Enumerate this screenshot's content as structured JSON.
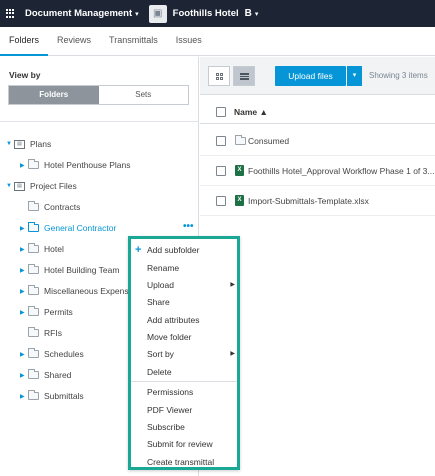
{
  "topbar": {
    "app_title": "Document Management",
    "project_name": "Foothills Hotel",
    "project_badge": "B",
    "caret": "▾"
  },
  "tabs": [
    {
      "label": "Folders",
      "active": true
    },
    {
      "label": "Reviews"
    },
    {
      "label": "Transmittals"
    },
    {
      "label": "Issues"
    }
  ],
  "viewby": {
    "label": "View by",
    "options": [
      "Folders",
      "Sets"
    ],
    "selected": "Folders"
  },
  "tree": [
    {
      "label": "Plans",
      "icon": "project-icon"
    },
    {
      "label": "Hotel Penthouse Plans",
      "icon": "folder-icon"
    },
    {
      "label": "Project Files",
      "icon": "project-icon"
    },
    {
      "label": "Contracts",
      "icon": "folder-icon"
    },
    {
      "label": "General Contractor",
      "icon": "folder-icon",
      "selected": true
    },
    {
      "label": "Hotel",
      "icon": "folder-icon"
    },
    {
      "label": "Hotel Building Team",
      "icon": "folder-icon"
    },
    {
      "label": "Miscellaneous Expenses",
      "icon": "folder-icon"
    },
    {
      "label": "Permits",
      "icon": "folder-icon"
    },
    {
      "label": "RFIs",
      "icon": "folder-icon"
    },
    {
      "label": "Schedules",
      "icon": "folder-icon"
    },
    {
      "label": "Shared",
      "icon": "folder-icon"
    },
    {
      "label": "Submittals",
      "icon": "folder-icon"
    }
  ],
  "toolbar": {
    "upload_label": "Upload files",
    "showing": "Showing 3 items"
  },
  "table": {
    "column_name": "Name ▲",
    "rows": [
      {
        "name": "Consumed",
        "type": "folder"
      },
      {
        "name": "Foothills Hotel_Approval Workflow Phase 1 of 3...",
        "type": "xlsx"
      },
      {
        "name": "Import-Submittals-Template.xlsx",
        "type": "xlsx"
      }
    ]
  },
  "context_menu": {
    "items": [
      "Add subfolder",
      "Rename",
      "Upload",
      "Share",
      "Add attributes",
      "Move folder",
      "Sort by",
      "Delete",
      "Permissions",
      "PDF Viewer",
      "Subscribe",
      "Submit for review",
      "Create transmittal"
    ]
  },
  "colors": {
    "topbar": "#1d2535",
    "accent": "#0696d7",
    "menu_highlight": "#1aa896",
    "excel": "#1e7145"
  }
}
